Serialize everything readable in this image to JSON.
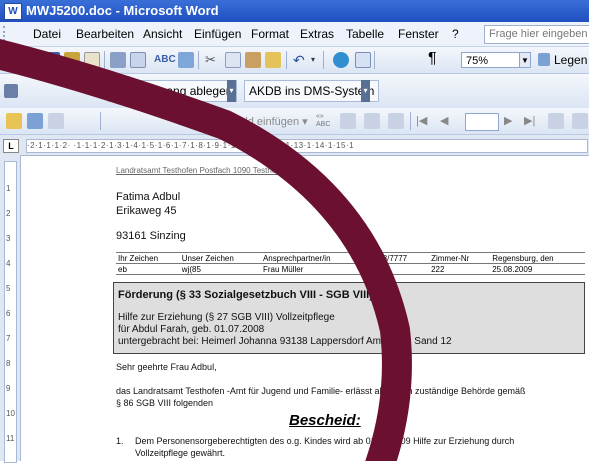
{
  "window": {
    "title": "MWJ5200.doc - Microsoft Word",
    "app_icon": "word-document-icon"
  },
  "menu": {
    "items": [
      "Datei",
      "Bearbeiten",
      "Ansicht",
      "Einfügen",
      "Format",
      "Extras",
      "Tabelle",
      "Fenster",
      "?"
    ],
    "help_placeholder": "Frage hier eingeben"
  },
  "standard_toolbar": {
    "zoom": "75%",
    "read_label": "Legen",
    "paragraph_mark": "¶",
    "icons": [
      "new-document-icon",
      "open-icon",
      "save-icon",
      "permission-icon",
      "email-icon",
      "print-icon",
      "print-preview-icon",
      "spelling-icon",
      "research-icon",
      "cut-icon",
      "copy-icon",
      "paste-icon",
      "format-painter-icon",
      "undo-icon",
      "hyperlink-icon",
      "tables-borders-icon",
      "show-hide-icon"
    ]
  },
  "dms_toolbar": {
    "btn_vorgang": "in Vorgang ablegen",
    "btn_akdb": "AKDB ins DMS-System"
  },
  "mailmerge_toolbar": {
    "field_text": "Bedingungsfeld einfügen ▾"
  },
  "ruler": {
    "h_marks": "·2·1·1·1·2· ·1·1·1·2·1·3·1·4·1·5·1·6·1·7·1·8·1·9·1·10·1·11·1·12·1·13·1·14·1·15·1",
    "v_marks": [
      "1",
      "2",
      "3",
      "4",
      "5",
      "6",
      "7",
      "8",
      "9",
      "10",
      "11"
    ]
  },
  "document": {
    "sender_line": "Landratsamt Testhofen Postfach 1090 Testhofen",
    "recipient": {
      "name": "Fatima Adbul",
      "street": "Erikaweg 45",
      "city": "93161 Sinzing"
    },
    "info_table": {
      "headers": [
        "Ihr Zeichen",
        "Unser Zeichen",
        "Ansprechpartner/in",
        "-8888/7777",
        "Zimmer-Nr",
        "Regensburg, den"
      ],
      "values": [
        "eb",
        "wj(85",
        "Frau Müller",
        "9",
        "222",
        "25.08.2009"
      ]
    },
    "box": {
      "title": "Förderung (§ 33 Sozialgesetzbuch VIII - SGB VIII);",
      "line1": "Hilfe zur Erziehung (§ 27 SGB VIII) Vollzeitpflege",
      "line2": "für Abdul Farah, geb. 01.07.2008",
      "line3": "untergebracht bei: Heimerl Johanna 93138 Lappersdorf Am hohen Sand 12"
    },
    "salutation": "Sehr geehrte Frau Adbul,",
    "para1_a": "das Landratsamt Testhofen -Amt für Jugend und Familie- erlässt als örtlich zuständige Behörde gemäß",
    "para1_b": "§ 86 SGB VIII folgenden",
    "heading": "Bescheid:",
    "item1_num": "1.",
    "item1_a": "Dem Personensorgeberechtigten des o.g. Kindes wird ab 01.09.2009 Hilfe zur Erziehung durch",
    "item1_b": "Vollzeitpflege gewährt."
  },
  "annotation": {
    "color": "#6b1030"
  }
}
